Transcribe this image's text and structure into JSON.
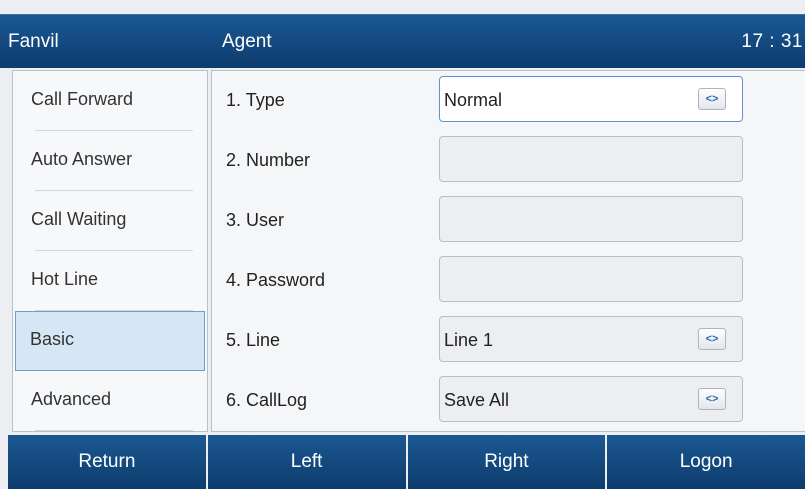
{
  "header": {
    "brand": "Fanvil",
    "title": "Agent",
    "time": "17 : 31"
  },
  "menu": {
    "items": [
      {
        "label": "Call Forward"
      },
      {
        "label": "Auto Answer"
      },
      {
        "label": "Call Waiting"
      },
      {
        "label": "Hot Line"
      },
      {
        "label": "Basic",
        "active": true
      },
      {
        "label": "Advanced"
      }
    ]
  },
  "form": {
    "rows": [
      {
        "label": "1. Type",
        "value": "Normal",
        "control": "select"
      },
      {
        "label": "2. Number",
        "value": "",
        "control": "text"
      },
      {
        "label": "3. User",
        "value": "",
        "control": "text"
      },
      {
        "label": "4. Password",
        "value": "",
        "control": "password"
      },
      {
        "label": "5. Line",
        "value": "Line 1",
        "control": "select"
      },
      {
        "label": "6. CallLog",
        "value": "Save All",
        "control": "select"
      }
    ],
    "switch_glyph": "<>"
  },
  "softkeys": {
    "return": "Return",
    "left": "Left",
    "right": "Right",
    "logon": "Logon"
  },
  "colors": {
    "header": "#0d3c6e",
    "active_bg": "#d6e6f4",
    "active_border": "#6a9fd0"
  }
}
